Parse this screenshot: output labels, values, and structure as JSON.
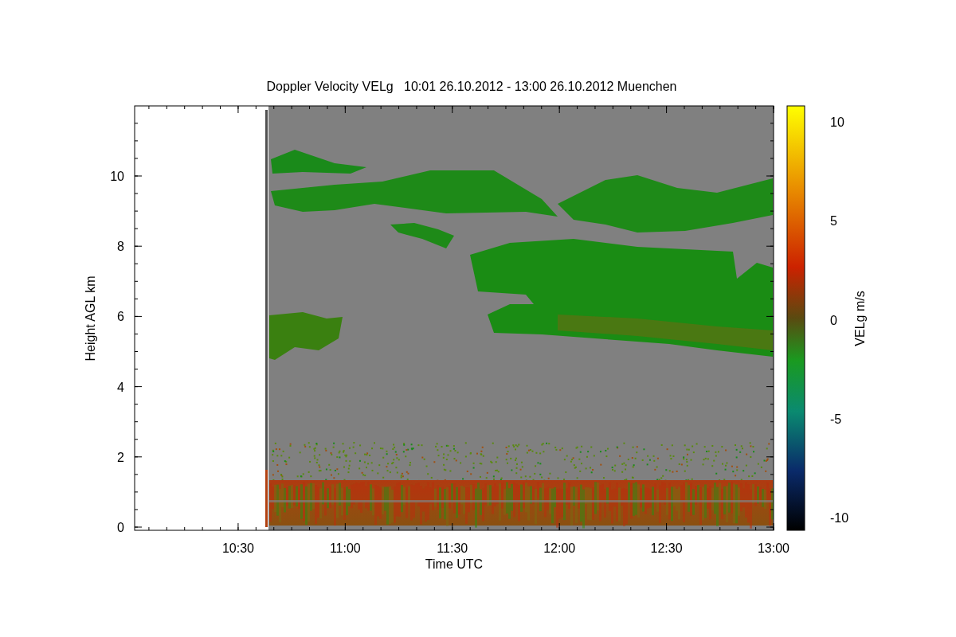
{
  "title": "Doppler Velocity VELg   10:01 26.10.2012 - 13:00 26.10.2012 Muenchen",
  "x_axis": {
    "label": "Time UTC",
    "ticks": [
      "10:30",
      "11:00",
      "11:30",
      "12:00",
      "12:30",
      "13:00"
    ]
  },
  "y_axis": {
    "label": "Height AGL km",
    "ticks": [
      "10",
      "8",
      "6",
      "4",
      "2",
      "0"
    ]
  },
  "colorbar": {
    "label": "VELg m/s",
    "ticks": [
      "10",
      "5",
      "0",
      "-5",
      "-10"
    ]
  }
}
